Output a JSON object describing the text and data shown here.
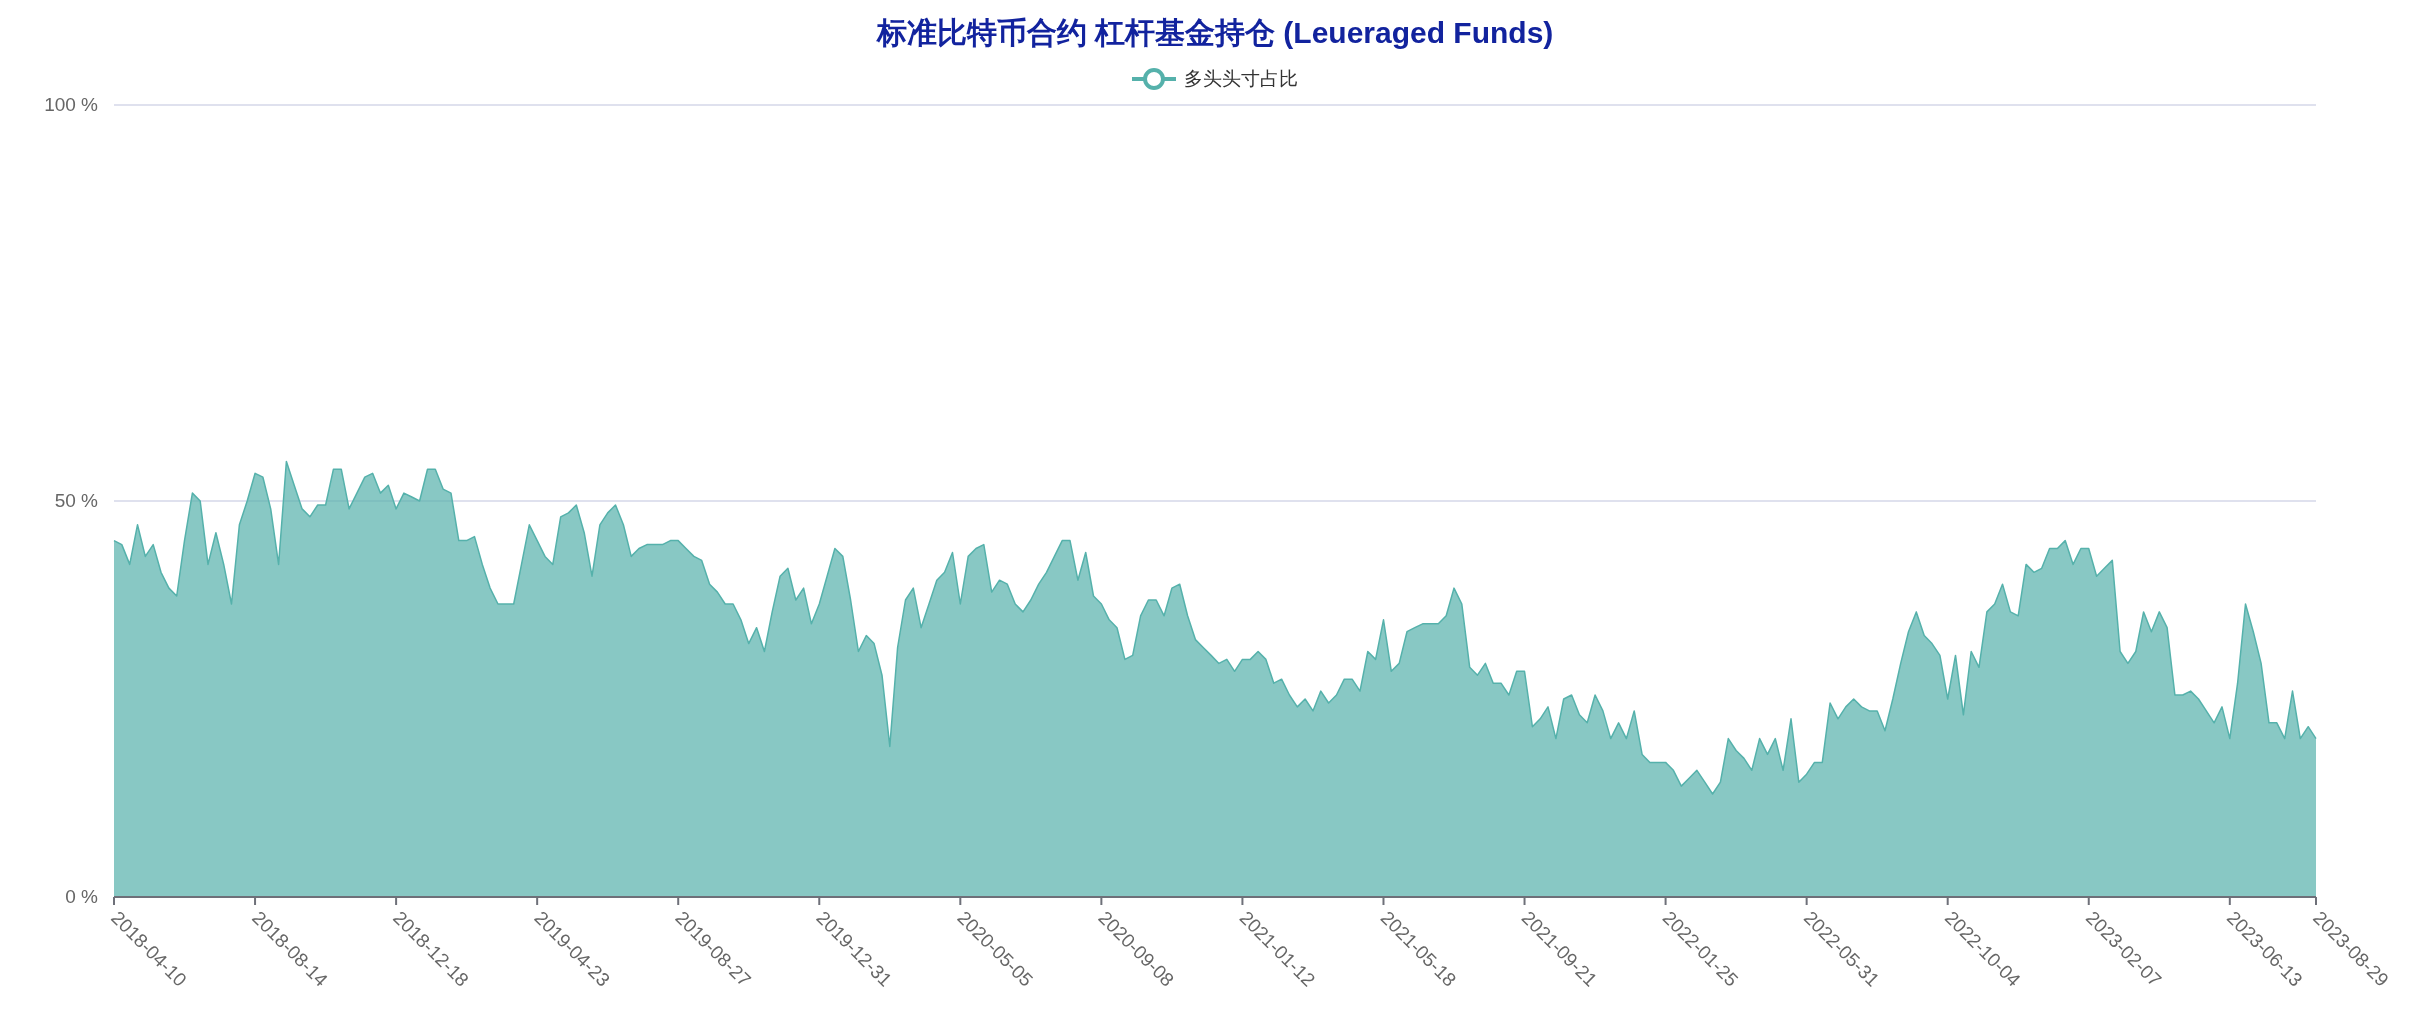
{
  "chart_data": {
    "type": "area",
    "title": "标准比特币合约 杠杆基金持仓 (Leueraged Funds)",
    "series": [
      {
        "name": "多头头寸占比",
        "color": "#55b1ab",
        "values": [
          45,
          44.5,
          42,
          47,
          43,
          44.5,
          41,
          39,
          38,
          45,
          51,
          50,
          42,
          46,
          42,
          37,
          47,
          50,
          53.5,
          53,
          49,
          42,
          55,
          52,
          49,
          48,
          49.5,
          49.5,
          54,
          54,
          49,
          51,
          53,
          53.5,
          51,
          52,
          49,
          51,
          50.5,
          50,
          54,
          54,
          51.5,
          51,
          45,
          45,
          45.5,
          42,
          39,
          37,
          37,
          37,
          42,
          47,
          45,
          43,
          42,
          48,
          48.5,
          49.5,
          46,
          40.5,
          47,
          48.5,
          49.5,
          47,
          43,
          44,
          44.5,
          44.5,
          44.5,
          45,
          45,
          44,
          43,
          42.5,
          39.5,
          38.5,
          37,
          37,
          35,
          32,
          34,
          31,
          36,
          40.5,
          41.5,
          37.5,
          39,
          34.5,
          37,
          40.5,
          44,
          43,
          37.5,
          31,
          33,
          32,
          28,
          19,
          31.5,
          37.5,
          39,
          34,
          37,
          40,
          41,
          43.5,
          37,
          43,
          44,
          44.5,
          38.5,
          40,
          39.5,
          37,
          36,
          37.5,
          39.5,
          41,
          43,
          45,
          45,
          40,
          43.5,
          38,
          37,
          35,
          34,
          30,
          30.5,
          35.5,
          37.5,
          37.5,
          35.5,
          39,
          39.5,
          35.5,
          32.5,
          31.5,
          30.5,
          29.5,
          30,
          28.5,
          30,
          30,
          31,
          30,
          27,
          27.5,
          25.5,
          24,
          25,
          23.5,
          26,
          24.5,
          25.5,
          27.5,
          27.5,
          26,
          31,
          30,
          35,
          28.5,
          29.5,
          33.5,
          34,
          34.5,
          34.5,
          34.5,
          35.5,
          39,
          37,
          29,
          28,
          29.5,
          27,
          27,
          25.5,
          28.5,
          28.5,
          21.5,
          22.5,
          24,
          20,
          25,
          25.5,
          23,
          22,
          25.5,
          23.5,
          20,
          22,
          20,
          23.5,
          18,
          17,
          17,
          17,
          16,
          14,
          15,
          16,
          14.5,
          13,
          14.5,
          20,
          18.5,
          17.5,
          16,
          20,
          18,
          20,
          16,
          22.5,
          14.5,
          15.5,
          17,
          17,
          24.5,
          22.5,
          24,
          25,
          24,
          23.5,
          23.5,
          21,
          25,
          29.5,
          33.5,
          36,
          33,
          32,
          30.5,
          25,
          30.5,
          23,
          31,
          29,
          36,
          37,
          39.5,
          36,
          35.5,
          42,
          41,
          41.5,
          44,
          44,
          45,
          42,
          44,
          44,
          40.5,
          41.5,
          42.5,
          31,
          29.5,
          31,
          36,
          33.5,
          36,
          34,
          25.5,
          25.5,
          26,
          25,
          23.5,
          22,
          24,
          20,
          27,
          37,
          33.5,
          29.5,
          22,
          22,
          20,
          26,
          20,
          21.5,
          20
        ]
      }
    ],
    "ylim": [
      0,
      100
    ],
    "categories": [
      "2018-04-10",
      null,
      null,
      null,
      null,
      null,
      null,
      null,
      null,
      null,
      null,
      null,
      null,
      null,
      null,
      null,
      null,
      null,
      "2018-08-14",
      null,
      null,
      null,
      null,
      null,
      null,
      null,
      null,
      null,
      null,
      null,
      null,
      null,
      null,
      null,
      null,
      null,
      "2018-12-18",
      null,
      null,
      null,
      null,
      null,
      null,
      null,
      null,
      null,
      null,
      null,
      null,
      null,
      null,
      null,
      null,
      null,
      "2019-04-23",
      null,
      null,
      null,
      null,
      null,
      null,
      null,
      null,
      null,
      null,
      null,
      null,
      null,
      null,
      null,
      null,
      null,
      "2019-08-27",
      null,
      null,
      null,
      null,
      null,
      null,
      null,
      null,
      null,
      null,
      null,
      null,
      null,
      null,
      null,
      null,
      null,
      "2019-12-31",
      null,
      null,
      null,
      null,
      null,
      null,
      null,
      null,
      null,
      null,
      null,
      null,
      null,
      null,
      null,
      null,
      null,
      "2020-05-05",
      null,
      null,
      null,
      null,
      null,
      null,
      null,
      null,
      null,
      null,
      null,
      null,
      null,
      null,
      null,
      null,
      null,
      "2020-09-08",
      null,
      null,
      null,
      null,
      null,
      null,
      null,
      null,
      null,
      null,
      null,
      null,
      null,
      null,
      null,
      null,
      null,
      "2021-01-12",
      null,
      null,
      null,
      null,
      null,
      null,
      null,
      null,
      null,
      null,
      null,
      null,
      null,
      null,
      null,
      null,
      null,
      "2021-05-18",
      null,
      null,
      null,
      null,
      null,
      null,
      null,
      null,
      null,
      null,
      null,
      null,
      null,
      null,
      null,
      null,
      null,
      "2021-09-21",
      null,
      null,
      null,
      null,
      null,
      null,
      null,
      null,
      null,
      null,
      null,
      null,
      null,
      null,
      null,
      null,
      null,
      "2022-01-25",
      null,
      null,
      null,
      null,
      null,
      null,
      null,
      null,
      null,
      null,
      null,
      null,
      null,
      null,
      null,
      null,
      null,
      "2022-05-31",
      null,
      null,
      null,
      null,
      null,
      null,
      null,
      null,
      null,
      null,
      null,
      null,
      null,
      null,
      null,
      null,
      null,
      "2022-10-04",
      null,
      null,
      null,
      null,
      null,
      null,
      null,
      null,
      null,
      null,
      null,
      null,
      null,
      null,
      null,
      null,
      null,
      "2023-02-07",
      null,
      null,
      null,
      null,
      null,
      null,
      null,
      null,
      null,
      null,
      null,
      null,
      null,
      null,
      null,
      null,
      null,
      "2023-06-13",
      null,
      null,
      null,
      null,
      null,
      null,
      null,
      null,
      null,
      null,
      "2023-08-29"
    ],
    "yticks": [
      {
        "value": 0,
        "label": "0 %"
      },
      {
        "value": 50,
        "label": "50 %"
      },
      {
        "value": 100,
        "label": "100 %"
      }
    ]
  }
}
